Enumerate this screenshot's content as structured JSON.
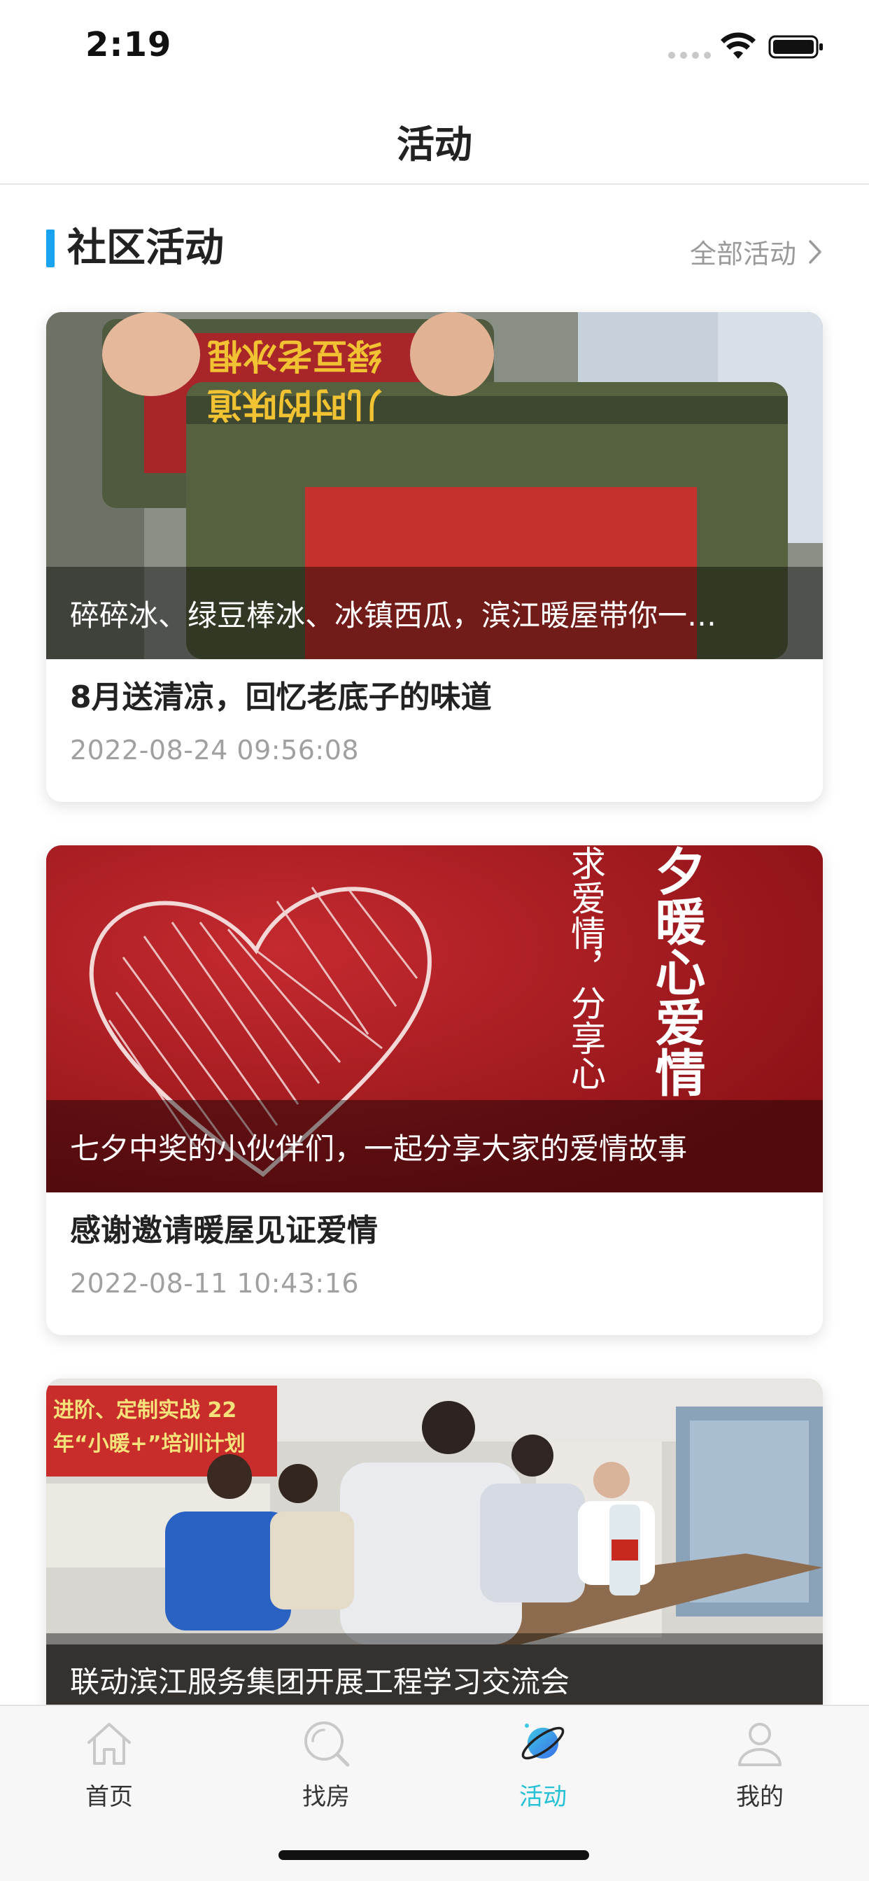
{
  "status_bar": {
    "time": "2:19"
  },
  "nav": {
    "title": "活动"
  },
  "section": {
    "title": "社区活动",
    "all_link": "全部活动"
  },
  "cards": [
    {
      "overlay": "碎碎冰、绿豆棒冰、冰镇西瓜，滨江暖屋带你一…",
      "title": "8月送清凉，回忆老底子的味道",
      "date": "2022-08-24 09:56:08",
      "image_text_1": "绿豆老冰棍",
      "image_text_2": "儿时的味道"
    },
    {
      "overlay": "七夕中奖的小伙伴们，一起分享大家的爱情故事",
      "title": "感谢邀请暖屋见证爱情",
      "date": "2022-08-11 10:43:16",
      "image_text_1": "夕暖心爱情",
      "image_text_2": "求爱情，分享心"
    },
    {
      "overlay": "联动滨江服务集团开展工程学习交流会",
      "banner": "进阶、定制实战 22年“小暖+”培训计划"
    }
  ],
  "tabs": [
    {
      "label": "首页",
      "icon": "home-icon"
    },
    {
      "label": "找房",
      "icon": "search-icon"
    },
    {
      "label": "活动",
      "icon": "planet-icon",
      "active": true
    },
    {
      "label": "我的",
      "icon": "user-icon"
    }
  ],
  "colors": {
    "accent": "#1aa3f0",
    "tab_active": "#27c1d6"
  }
}
